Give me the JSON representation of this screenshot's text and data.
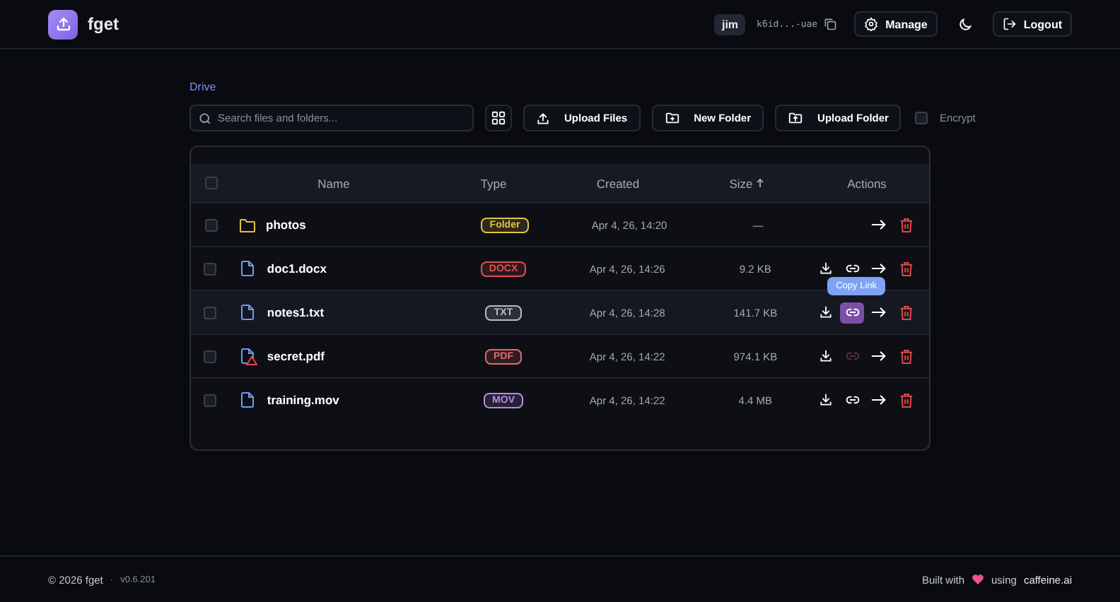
{
  "header": {
    "app_name": "fget",
    "user": "jim",
    "principal": "k6id...-uae",
    "buttons": [
      {
        "kind": "manage",
        "label": "Manage"
      },
      {
        "kind": "theme"
      },
      {
        "kind": "logout",
        "label": "Logout"
      }
    ]
  },
  "breadcrumb": "Drive",
  "search": {
    "placeholder": "Search files and folders..."
  },
  "toolbar": [
    {
      "kind": "grid"
    },
    {
      "kind": "upload",
      "label": "Upload Files"
    },
    {
      "kind": "folder",
      "label": "New Folder"
    },
    {
      "kind": "folder-upload",
      "label": "Upload Folder"
    }
  ],
  "encrypt": {
    "label": "Encrypt",
    "checked": false
  },
  "table": {
    "select_all_checked": false,
    "columns": [
      "Name",
      "Type",
      "Created",
      "Size",
      "Actions"
    ],
    "rows": [
      {
        "kind": "folder",
        "name": "photos",
        "type": "Folder",
        "color": "#e3c341",
        "created": "Apr 4, 26, 14:20",
        "size": "—",
        "checked": false
      },
      {
        "kind": "file",
        "name": "doc1.docx",
        "type": "DOCX",
        "color": "#e05252",
        "created": "Apr 4, 26, 14:26",
        "size": "9.2 KB",
        "checked": false,
        "locked": false,
        "link_active": false,
        "link_disabled": false
      },
      {
        "kind": "file",
        "name": "notes1.txt",
        "type": "TXT",
        "color": "#b8bcc8",
        "created": "Apr 4, 26, 14:28",
        "size": "141.7 KB",
        "checked": false,
        "locked": false,
        "link_active": true,
        "link_disabled": false,
        "tooltip": "Copy Link"
      },
      {
        "kind": "file",
        "name": "secret.pdf",
        "type": "PDF",
        "color": "#e46a6a",
        "created": "Apr 4, 26, 14:22",
        "size": "974.1 KB",
        "checked": false,
        "locked": true,
        "link_active": false,
        "link_disabled": true
      },
      {
        "kind": "file",
        "name": "training.mov",
        "type": "MOV",
        "color": "#b48ce8",
        "created": "Apr 4, 26, 14:22",
        "size": "4.4 MB",
        "checked": false,
        "locked": false,
        "link_active": false,
        "link_disabled": false
      }
    ]
  },
  "footer": {
    "copyright": "© 2026 fget",
    "separator": "·",
    "version": "v0.6.201",
    "built_with": "Built with",
    "using": "using",
    "brand": "caffeine.ai"
  }
}
